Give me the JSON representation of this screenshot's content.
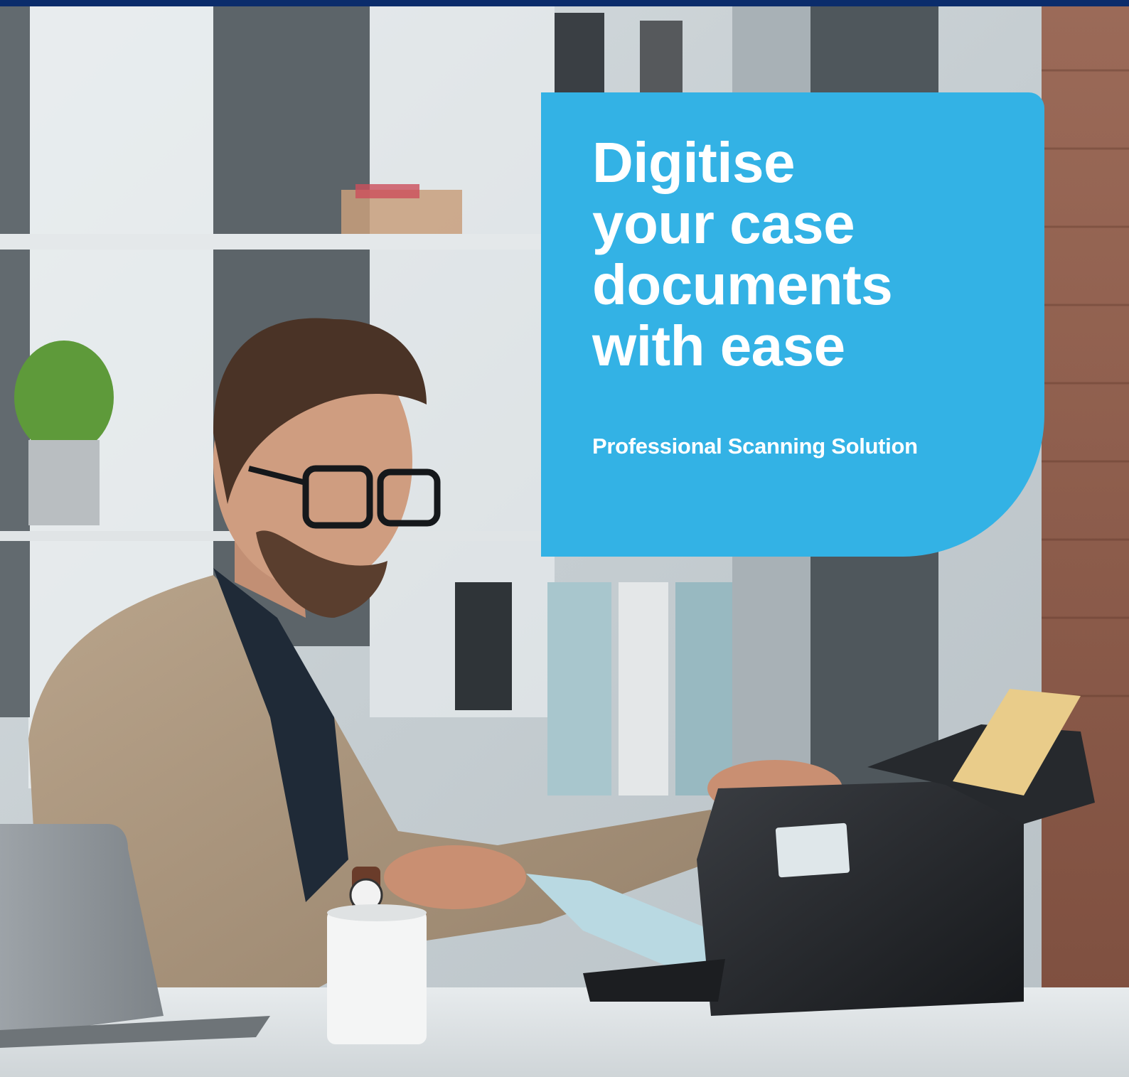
{
  "hero": {
    "headline_lines": [
      "Digitise",
      "your case",
      "documents",
      "with ease"
    ],
    "subheadline": "Professional Scanning Solution"
  },
  "colors": {
    "top_bar": "#0b2c6b",
    "card_accent": "#33b2e5",
    "text": "#ffffff"
  }
}
